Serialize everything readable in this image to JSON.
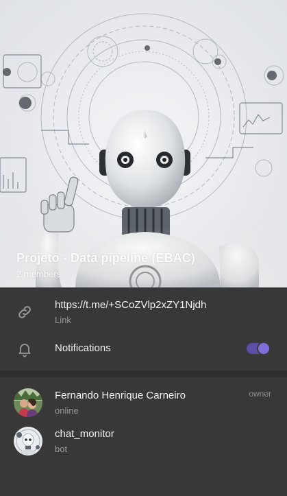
{
  "header": {
    "title": "Projeto - Data pipeline (EBAC)",
    "subtitle": "2 members"
  },
  "info": {
    "link": {
      "icon": "link-icon",
      "value": "https://t.me/+SCoZVlp2xZY1Njdh",
      "caption": "Link"
    },
    "notifications": {
      "icon": "bell-icon",
      "label": "Notifications",
      "enabled": true
    }
  },
  "members": [
    {
      "name": "Fernando Henrique Carneiro",
      "status": "online",
      "role": "owner",
      "avatar": "avatar-photo-couple"
    },
    {
      "name": "chat_monitor",
      "status": "bot",
      "role": "",
      "avatar": "avatar-robot"
    }
  ],
  "colors": {
    "background": "#383838",
    "accent": "#7e6fdb",
    "secondary_text": "#9a9a9a"
  }
}
